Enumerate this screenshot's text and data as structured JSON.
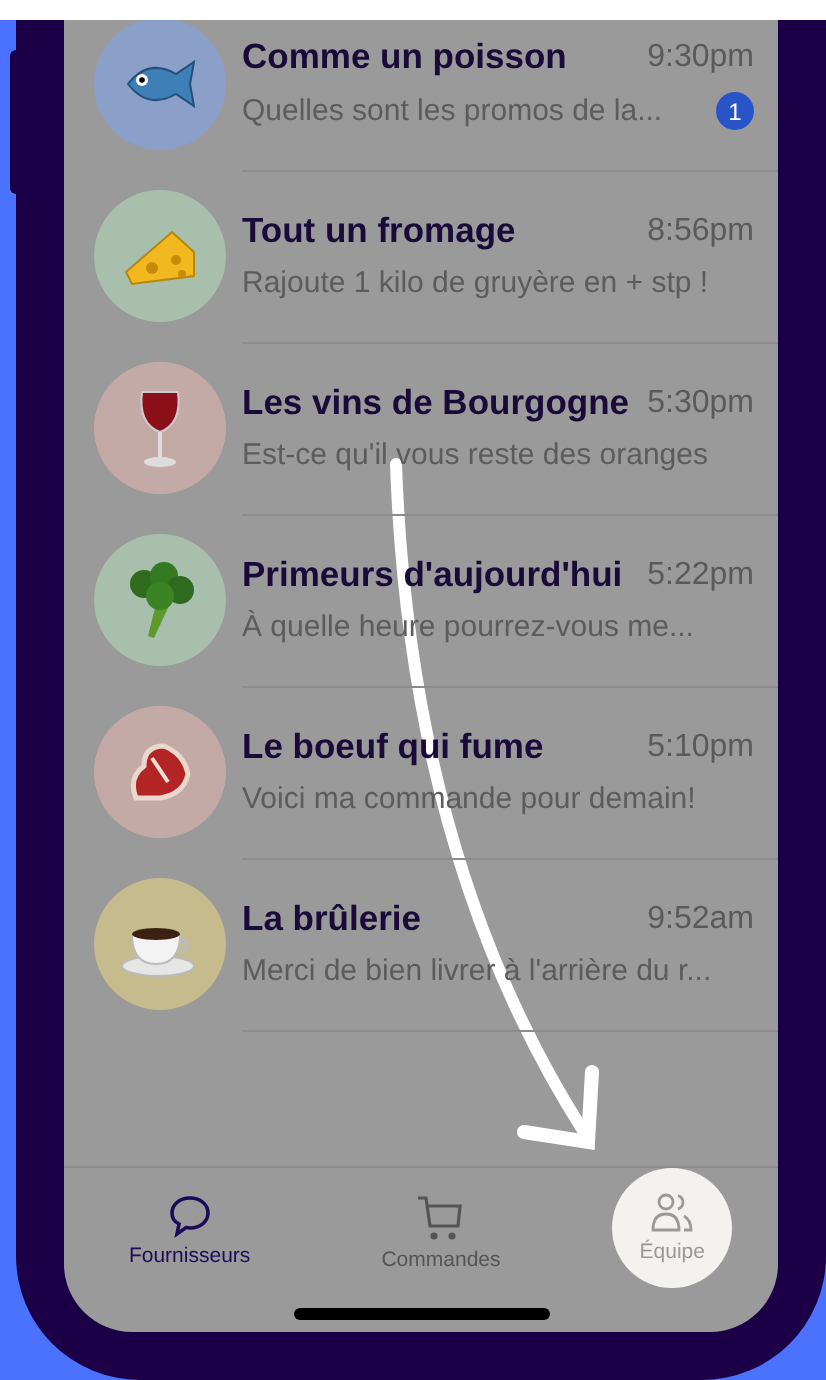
{
  "conversations": [
    {
      "name": "Comme un poisson",
      "time": "9:30pm",
      "preview": "Quelles sont les promos de la...",
      "unread": "1",
      "color": "#8aa0c8"
    },
    {
      "name": "Tout un fromage",
      "time": "8:56pm",
      "preview": "Rajoute 1 kilo de gruyère en + stp !",
      "color": "#a9bfae"
    },
    {
      "name": "Les vins de Bourgogne",
      "time": "5:30pm",
      "preview": "Est-ce qu'il vous reste des oranges",
      "color": "#c4aaa7"
    },
    {
      "name": "Primeurs d'aujourd'hui",
      "time": "5:22pm",
      "preview": "À quelle heure pourrez-vous me...",
      "color": "#a9bfae"
    },
    {
      "name": "Le boeuf qui fume",
      "time": "5:10pm",
      "preview": "Voici ma commande pour demain!",
      "color": "#c4aaa7"
    },
    {
      "name": "La brûlerie",
      "time": "9:52am",
      "preview": "Merci de bien livrer à l'arrière du r...",
      "color": "#c6bb8c"
    }
  ],
  "tab_bar": [
    {
      "label": "Fournisseurs",
      "selected": true,
      "spotlight": false
    },
    {
      "label": "Commandes",
      "selected": false,
      "spotlight": false
    },
    {
      "label": "Équipe",
      "selected": false,
      "spotlight": true
    }
  ]
}
